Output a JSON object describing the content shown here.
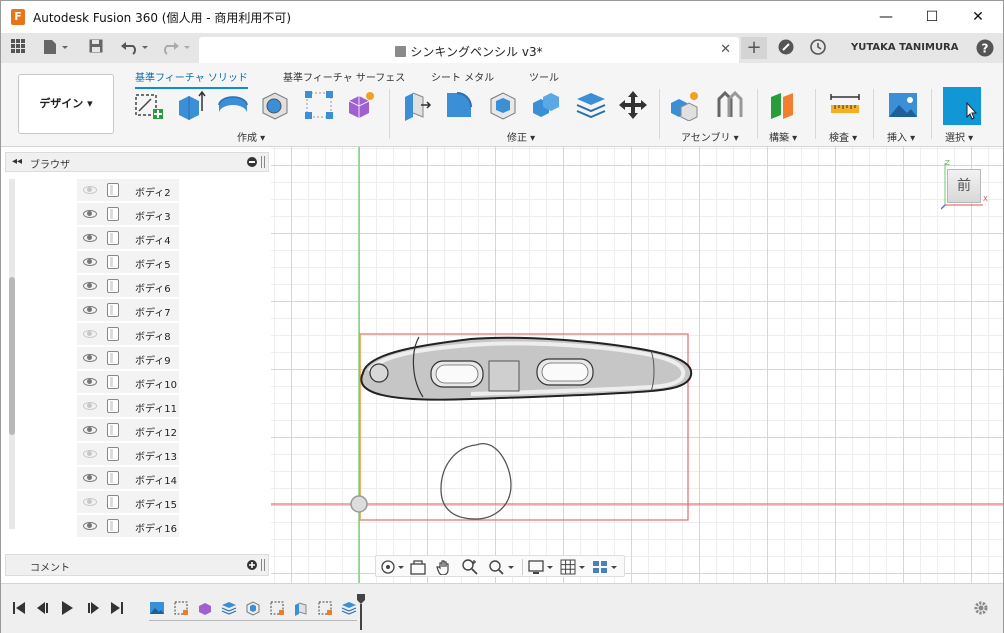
{
  "window": {
    "title": "Autodesk Fusion 360 (個人用 - 商用利用不可)",
    "logo_letter": "F",
    "minimize": "—",
    "maximize": "☐",
    "close": "✕"
  },
  "tabbar": {
    "doc_tab_label": "シンキングペンシル v3*",
    "doc_tab_close": "✕",
    "new_tab": "+",
    "user_name": "YUTAKA TANIMURA",
    "help": "?"
  },
  "ribbon": {
    "workspace": "デザイン ▾",
    "tabs": [
      {
        "label": "基準フィーチャ ソリッド",
        "active": true
      },
      {
        "label": "基準フィーチャ サーフェス",
        "active": false
      },
      {
        "label": "シート メタル",
        "active": false
      },
      {
        "label": "ツール",
        "active": false
      }
    ],
    "groups": {
      "create": "作成 ▾",
      "modify": "修正 ▾",
      "assemble": "アセンブリ ▾",
      "construct": "構築 ▾",
      "inspect": "検査 ▾",
      "insert": "挿入 ▾",
      "select": "選択 ▾"
    }
  },
  "browser": {
    "title": "ブラウザ",
    "collapse": "◂◂",
    "items": [
      {
        "label": "ボディ2",
        "visible": false
      },
      {
        "label": "ボディ3",
        "visible": true
      },
      {
        "label": "ボディ4",
        "visible": true
      },
      {
        "label": "ボディ5",
        "visible": true
      },
      {
        "label": "ボディ6",
        "visible": true
      },
      {
        "label": "ボディ7",
        "visible": true
      },
      {
        "label": "ボディ8",
        "visible": false
      },
      {
        "label": "ボディ9",
        "visible": true
      },
      {
        "label": "ボディ10",
        "visible": true
      },
      {
        "label": "ボディ11",
        "visible": false
      },
      {
        "label": "ボディ12",
        "visible": true
      },
      {
        "label": "ボディ13",
        "visible": false
      },
      {
        "label": "ボディ14",
        "visible": true
      },
      {
        "label": "ボディ15",
        "visible": false
      },
      {
        "label": "ボディ16",
        "visible": true
      }
    ]
  },
  "comments": {
    "title": "コメント"
  },
  "viewcube": {
    "face": "前",
    "axis_z": "Z",
    "axis_x": "X"
  },
  "colors": {
    "accent": "#0a8fd0",
    "sketch_frame": "#e07070",
    "axis_green": "#66cc66",
    "axis_red": "#e05050"
  }
}
